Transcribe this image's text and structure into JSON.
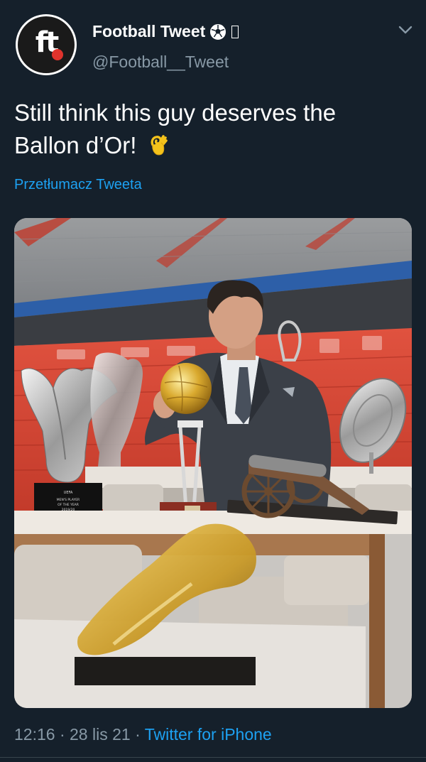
{
  "author": {
    "avatar_text": "ft",
    "name": "Football Tweet",
    "handle": "@Football__Tweet"
  },
  "tweet": {
    "text": "Still think this guy deserves the Ballon d’Or!",
    "emoji": "ok-hand-icon",
    "translate_label": "Przetłumacz Tweeta"
  },
  "media": {
    "trophy_plaque_text": "UEFA MEN'S PLAYER OF THE YEAR 2019/20"
  },
  "meta": {
    "time": "12:16",
    "date": "28 lis 21",
    "source": "Twitter for iPhone",
    "separator": "·"
  },
  "colors": {
    "background": "#15202b",
    "accent": "#1da1f2",
    "secondary_text": "#8899a6"
  }
}
